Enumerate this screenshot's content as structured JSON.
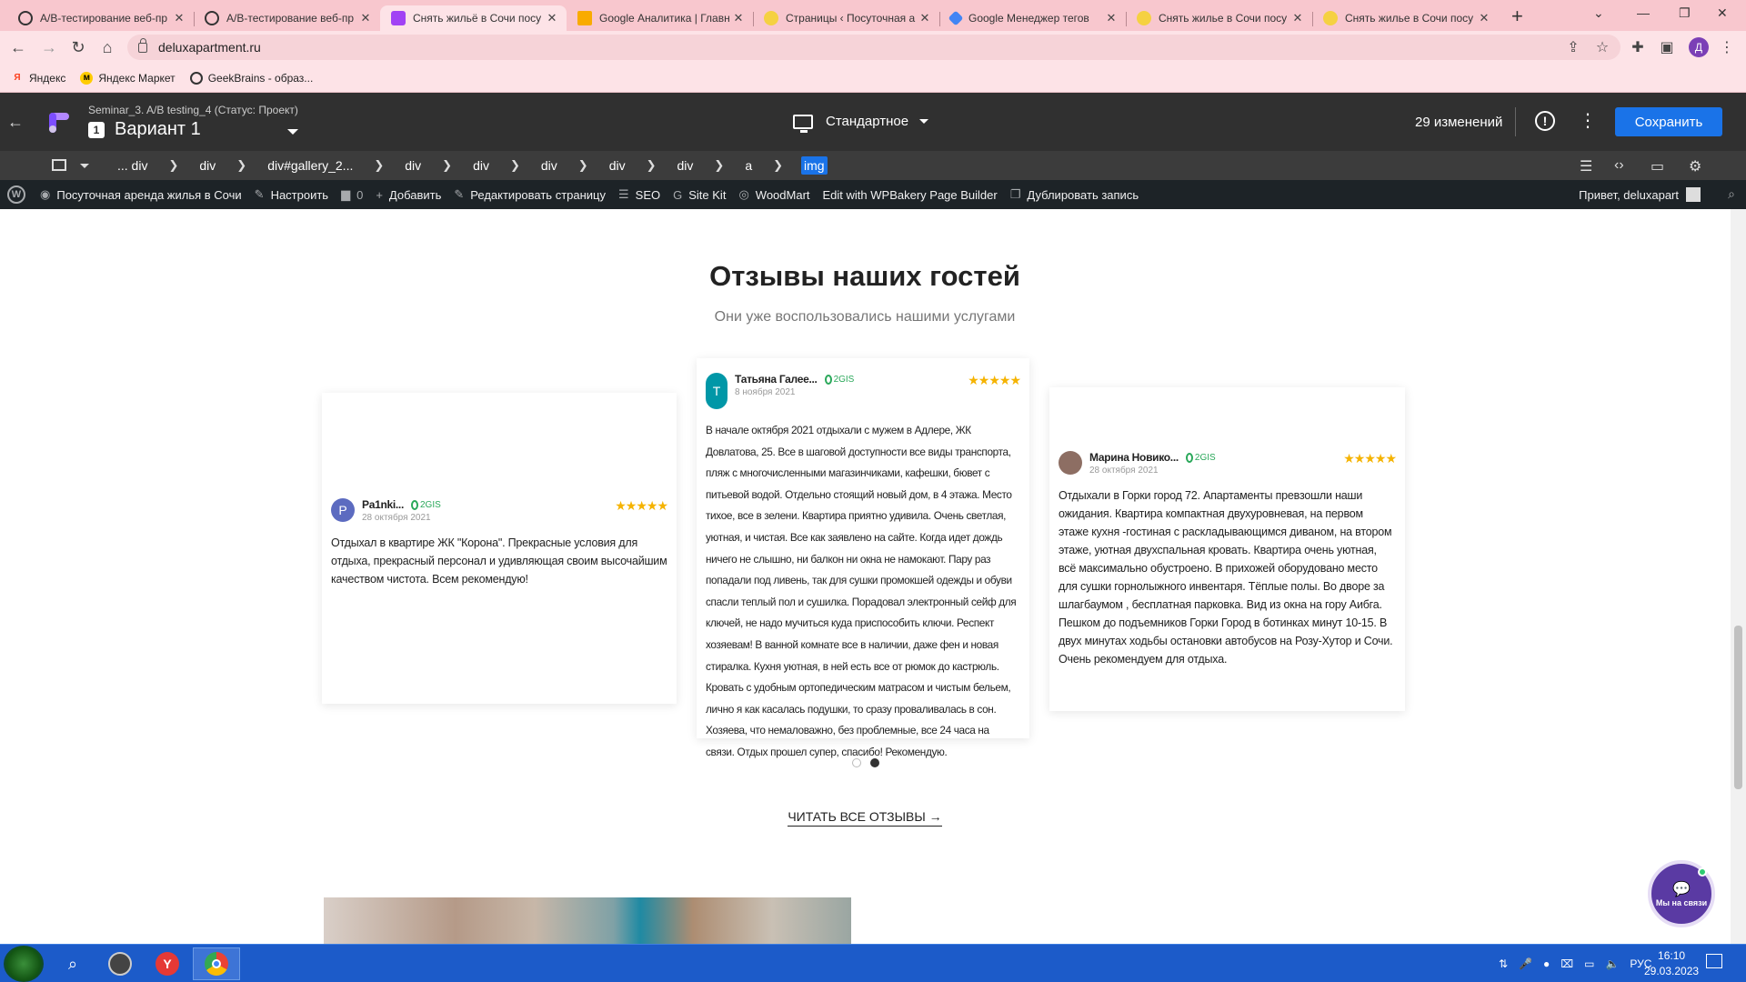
{
  "browser": {
    "tabs": [
      {
        "title": "A/B-тестирование веб-пр",
        "icon": "globe-icon",
        "color": "#333"
      },
      {
        "title": "A/B-тестирование веб-пр",
        "icon": "globe-icon",
        "color": "#333"
      },
      {
        "title": "Снять жильё в Сочи посу",
        "icon": "optimize-icon",
        "color": "#a142f4",
        "active": true
      },
      {
        "title": "Google Аналитика | Главн",
        "icon": "analytics-icon",
        "color": "#f9ab00"
      },
      {
        "title": "Страницы ‹ Посуточная а",
        "icon": "page-icon",
        "color": "#e6b800"
      },
      {
        "title": "Google Менеджер тегов",
        "icon": "tag-manager-icon",
        "color": "#4285f4"
      },
      {
        "title": "Снять жилье в Сочи посу",
        "icon": "page-icon",
        "color": "#e6b800"
      },
      {
        "title": "Снять жилье в Сочи посу",
        "icon": "page-icon",
        "color": "#e6b800"
      }
    ],
    "new_tab": "+",
    "url": "deluxapartment.ru",
    "profile_initial": "Д",
    "bookmarks": [
      {
        "label": "Яндекс",
        "icon": "yandex-icon",
        "color": "#fc3f1d"
      },
      {
        "label": "Яндекс Маркет",
        "icon": "market-icon",
        "color": "#ffcc00"
      },
      {
        "label": "GeekBrains - образ...",
        "icon": "geekbrains-icon",
        "color": "#333"
      }
    ]
  },
  "optimize": {
    "subtitle": "Seminar_3. A/B testing_4 (Статус: Проект)",
    "variant_number": "1",
    "variant_name": "Вариант 1",
    "device": "Стандартное",
    "changes": "29 изменений",
    "save_label": "Сохранить"
  },
  "breadcrumbs": [
    "... div",
    "div",
    "div#gallery_2...",
    "div",
    "div",
    "div",
    "div",
    "div",
    "a",
    "img"
  ],
  "wp_admin": {
    "items": [
      {
        "label": "Посуточная аренда жилья в Сочи",
        "icon": "dashboard-icon"
      },
      {
        "label": "Настроить",
        "icon": "brush-icon"
      },
      {
        "label": "0",
        "icon": "comment-icon"
      },
      {
        "label": "Добавить",
        "icon": "plus-icon"
      },
      {
        "label": "Редактировать страницу",
        "icon": "pencil-icon"
      },
      {
        "label": "SEO",
        "icon": "seo-icon"
      },
      {
        "label": "Site Kit",
        "icon": "google-icon"
      },
      {
        "label": "WoodMart",
        "icon": "woodmart-icon"
      },
      {
        "label": "Edit with WPBakery Page Builder",
        "icon": ""
      },
      {
        "label": "Дублировать запись",
        "icon": "duplicate-icon"
      }
    ],
    "greeting": "Привет, deluxapart"
  },
  "reviews_section": {
    "title": "Отзывы наших гостей",
    "subtitle": "Они уже воспользовались нашими услугами",
    "source": "2GIS",
    "stars": "★★★★★",
    "reviews": [
      {
        "initial": "P",
        "avatar_color": "#5c6bc0",
        "name": "Pa1nki...",
        "date": "28 октября 2021",
        "text": "Отдыхал в квартире ЖК \"Корона\". Прекрасные условия для отдыха, прекрасный персонал и удивляющая своим высочайшим качеством чистота. Всем рекомендую!"
      },
      {
        "initial": "Т",
        "avatar_color": "#0097a7",
        "name": "Татьяна Галее...",
        "date": "8 ноября 2021",
        "text": "В начале октября 2021 отдыхали с мужем в Адлере, ЖК Довлатова, 25. Все в шаговой доступности все виды транспорта, пляж с многочисленными магазинчиками, кафешки, бювет с питьевой водой. Отдельно стоящий новый дом, в 4 этажа. Место тихое, все в зелени. Квартира приятно удивила. Очень светлая, уютная, и чистая. Все как заявлено на сайте. Когда идет дождь ничего не слышно, ни балкон ни окна не намокают. Пару раз попадали под ливень, так для сушки промокшей одежды и обуви спасли теплый пол и сушилка. Порадовал электронный сейф для ключей, не надо мучиться куда приспособить ключи. Респект хозяевам! В ванной комнате все в наличии, даже фен и новая стиралка. Кухня уютная, в ней есть все от рюмок до кастрюль. Кровать с удобным ортопедическим матрасом и чистым бельем, лично я как касалась подушки, то сразу проваливалась в сон. Хозяева, что немаловажно, без проблемные, все 24 часа на связи. Отдых прошел супер, спасибо! Рекомендую."
      },
      {
        "initial": "",
        "avatar_color": "#8d6e63",
        "name": "Марина Новико...",
        "date": "28 октября 2021",
        "text": "Отдыхали в Горки город 72. Апартаменты превзошли наши ожидания. Квартира компактная двухуровневая, на первом этаже кухня -гостиная с раскладывающимся диваном, на втором этаже, уютная двухспальная кровать. Квартира очень уютная, всё максимально обустроено. В прихожей оборудовано место для сушки горнолыжного инвентаря. Тёплые полы. Во дворе за шлагбаумом , бесплатная парковка. Вид из окна на гору Аибга. Пешком до подъемников Горки Город в ботинках минут 10-15. В двух минутах ходьбы остановки автобусов на Розу-Хутор и Сочи. Очень рекомендуем для отдыха."
      }
    ],
    "read_all": "ЧИТАТЬ ВСЕ ОТЗЫВЫ →"
  },
  "chat_widget": {
    "label": "Мы на связи"
  },
  "taskbar": {
    "lang": "РУС",
    "time": "16:10",
    "date": "29.03.2023"
  }
}
